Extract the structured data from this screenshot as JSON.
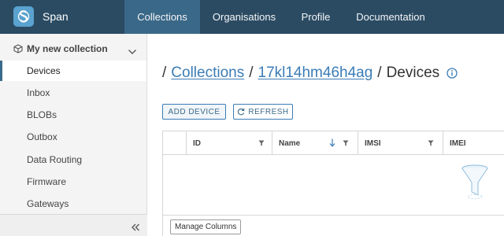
{
  "app": {
    "name": "Span",
    "accent": "#3b6a8a",
    "header_bg": "#2b4b63",
    "link_color": "#3b7cb5"
  },
  "nav": {
    "collections": "Collections",
    "organisations": "Organisations",
    "profile": "Profile",
    "documentation": "Documentation",
    "active": "Collections"
  },
  "sidebar": {
    "collection_title": "My new collection",
    "collection_icon": "box-icon",
    "items": [
      {
        "label": "Devices",
        "active": true
      },
      {
        "label": "Inbox"
      },
      {
        "label": "BLOBs"
      },
      {
        "label": "Outbox"
      },
      {
        "label": "Data Routing"
      },
      {
        "label": "Firmware"
      },
      {
        "label": "Gateways"
      }
    ],
    "collapse_icon": "double-chevron-left-icon"
  },
  "breadcrumb": {
    "root": "Collections",
    "collection_id": "17kl14hm46h4ag",
    "current": "Devices",
    "separator": "/",
    "info_icon": "info-icon"
  },
  "toolbar": {
    "add_label": "ADD DEVICE",
    "refresh_label": "REFRESH"
  },
  "table": {
    "columns": [
      {
        "label": "ID",
        "filter": true
      },
      {
        "label": "Name",
        "sort": "desc",
        "filter": true
      },
      {
        "label": "IMSI",
        "filter": true
      },
      {
        "label": "IMEI"
      }
    ],
    "rows": [],
    "empty_icon": "empty-funnel-icon",
    "manage_columns_label": "Manage Columns"
  }
}
